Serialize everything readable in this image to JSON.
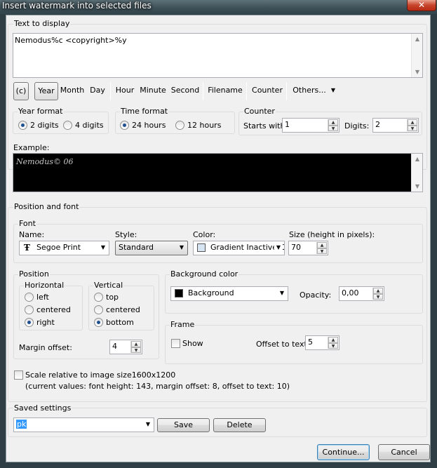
{
  "window": {
    "title": "Insert watermark into selected files",
    "close": "✕"
  },
  "text_section": {
    "label": "Text to display",
    "value": "Nemodus%c <copyright>%y"
  },
  "toolbar": {
    "copyright": "(c)",
    "year": "Year",
    "month": "Month",
    "day": "Day",
    "hour": "Hour",
    "minute": "Minute",
    "second": "Second",
    "filename": "Filename",
    "counter": "Counter",
    "others": "Others..."
  },
  "year_format": {
    "label": "Year format",
    "opt1": "2 digits",
    "opt2": "4 digits",
    "selected": "2 digits"
  },
  "time_format": {
    "label": "Time format",
    "opt1": "24 hours",
    "opt2": "12 hours",
    "selected": "24 hours"
  },
  "counter": {
    "label": "Counter",
    "starts_label": "Starts with:",
    "starts_value": "1",
    "digits_label": "Digits:",
    "digits_value": "2"
  },
  "example": {
    "label": "Example:",
    "value": "Nemodus© 06"
  },
  "position_font": {
    "label": "Position and font"
  },
  "font": {
    "label": "Font",
    "name_label": "Name:",
    "name_value": "Segoe Print",
    "style_label": "Style:",
    "style_value": "Standard",
    "color_label": "Color:",
    "color_value": "Gradient Inactive C",
    "size_label": "Size (height in pixels):",
    "size_value": "70",
    "color_swatch": "#d7e4f2"
  },
  "position": {
    "label": "Position",
    "horizontal_label": "Horizontal",
    "h_left": "left",
    "h_centered": "centered",
    "h_right": "right",
    "h_selected": "right",
    "vertical_label": "Vertical",
    "v_top": "top",
    "v_centered": "centered",
    "v_bottom": "bottom",
    "v_selected": "bottom",
    "margin_label": "Margin offset:",
    "margin_value": "4"
  },
  "background": {
    "label": "Background color",
    "value": "Background",
    "swatch": "#000000",
    "opacity_label": "Opacity:",
    "opacity_value": "0,00"
  },
  "frame": {
    "label": "Frame",
    "show_label": "Show",
    "show_checked": false,
    "offset_label": "Offset to text:",
    "offset_value": "5"
  },
  "scale": {
    "label": "Scale relative to image size1600x1200",
    "checked": false,
    "note": "(current values: font height: 143, margin offset: 8, offset to text: 10)"
  },
  "saved": {
    "label": "Saved settings",
    "value": "pk",
    "save": "Save",
    "delete": "Delete"
  },
  "buttons": {
    "continue": "Continue...",
    "cancel": "Cancel"
  }
}
